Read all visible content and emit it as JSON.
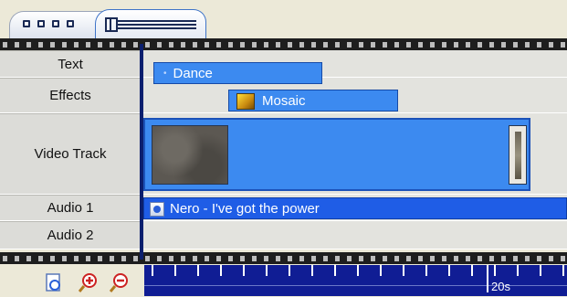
{
  "view_tabs": [
    {
      "name": "storyboard",
      "icon": "storyboard-icon",
      "active": false
    },
    {
      "name": "timeline",
      "icon": "timeline-icon",
      "active": true
    }
  ],
  "tracks": [
    {
      "label": "Text"
    },
    {
      "label": "Effects"
    },
    {
      "label": "Video Track"
    },
    {
      "label": "Audio 1"
    },
    {
      "label": "Audio 2"
    }
  ],
  "clips": {
    "text": {
      "label": "Dance"
    },
    "effect": {
      "label": "Mosaic"
    },
    "audio1": {
      "label": "Nero -  I've got the power"
    }
  },
  "toolbar": {
    "icons": [
      "page-icon",
      "zoom-in-icon",
      "zoom-out-icon"
    ]
  },
  "ruler": {
    "marker_label": "20s"
  },
  "colors": {
    "clip_blue": "#3c8af0",
    "audio_clip_blue": "#1f5de6",
    "ruler_bg": "#101d94",
    "playhead": "#0b1f6e"
  }
}
